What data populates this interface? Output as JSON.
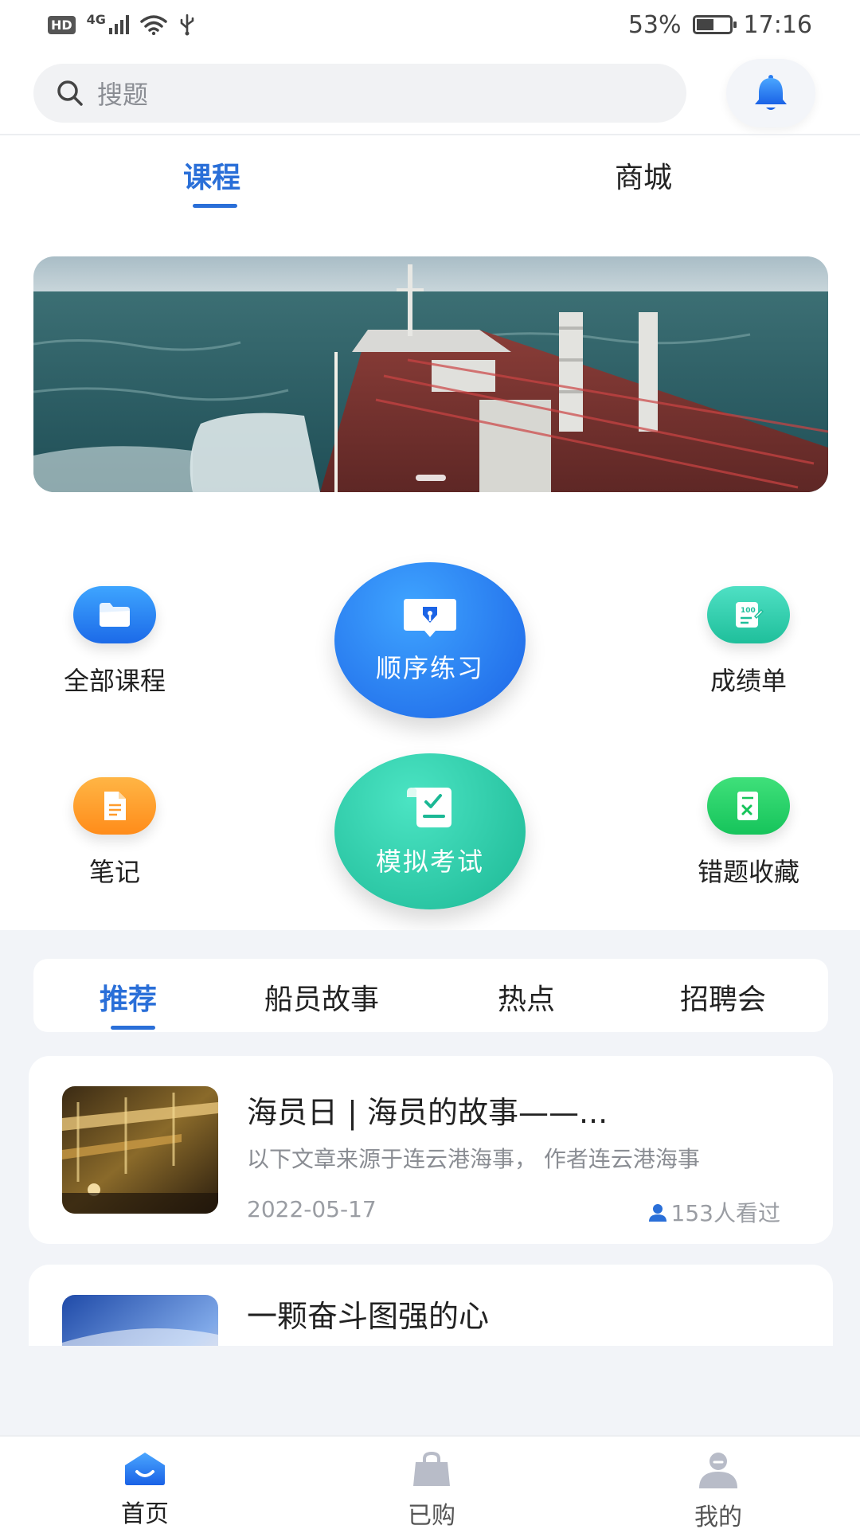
{
  "status_bar": {
    "network": "4G",
    "battery": "53%",
    "battery_level": 0.53,
    "time": "17:16"
  },
  "search": {
    "placeholder": "搜题"
  },
  "top_tabs": [
    {
      "label": "课程",
      "active": true
    },
    {
      "label": "商城",
      "active": false
    }
  ],
  "features": {
    "all_courses": "全部课程",
    "sequential_practice": "顺序练习",
    "score_sheet": "成绩单",
    "notes": "笔记",
    "mock_exam": "模拟考试",
    "wrong_favorites": "错题收藏"
  },
  "category_tabs": [
    {
      "label": "推荐",
      "active": true
    },
    {
      "label": "船员故事",
      "active": false
    },
    {
      "label": "热点",
      "active": false
    },
    {
      "label": "招聘会",
      "active": false
    }
  ],
  "articles": [
    {
      "title": "海员日 | 海员的故事——...",
      "summary": "以下文章来源于连云港海事， 作者连云港海事",
      "date": "2022-05-17",
      "views": "153人看过"
    },
    {
      "title": "一颗奋斗图强的心"
    }
  ],
  "bottom_nav": [
    {
      "label": "首页",
      "icon": "home-icon",
      "active": true
    },
    {
      "label": "已购",
      "icon": "shopping-bag-icon",
      "active": false
    },
    {
      "label": "我的",
      "icon": "user-icon",
      "active": false
    }
  ],
  "colors": {
    "accent": "#2a6fd8",
    "practice_blue": "#1c64e6",
    "exam_green": "#1cb895",
    "page_gray": "#f2f4f8"
  }
}
